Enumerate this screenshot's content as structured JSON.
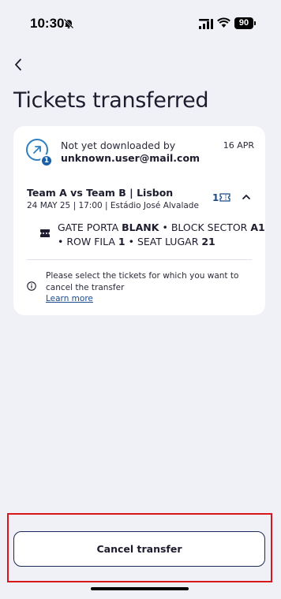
{
  "status_bar": {
    "time": "10:30",
    "battery": "90"
  },
  "header": {
    "title": "Tickets transferred"
  },
  "transfer_card": {
    "badge_count": "1",
    "recipient_status": "Not yet downloaded by",
    "recipient_email": "unknown.user@mail.com",
    "date": "16 APR",
    "event_title": "Team A vs Team B | Lisbon",
    "event_details": "24 MAY 25 | 17:00 | Estádio José Alvalade",
    "ticket_count": "1",
    "seat": {
      "gate_label": "GATE PORTA",
      "gate_value": "BLANK",
      "block_label": "BLOCK SECTOR",
      "block_value": "A1",
      "row_label": "ROW FILA",
      "row_value": "1",
      "seat_label": "SEAT LUGAR",
      "seat_value": "21",
      "separator": "•"
    },
    "info_text": "Please select the tickets for which you want to cancel the transfer",
    "learn_more": "Learn more"
  },
  "footer": {
    "cancel_button": "Cancel transfer"
  },
  "colors": {
    "background": "#f0f1f6",
    "accent": "#1c4a8c",
    "icon_blue": "#2f7fc1",
    "highlight_border": "#d9161c"
  }
}
